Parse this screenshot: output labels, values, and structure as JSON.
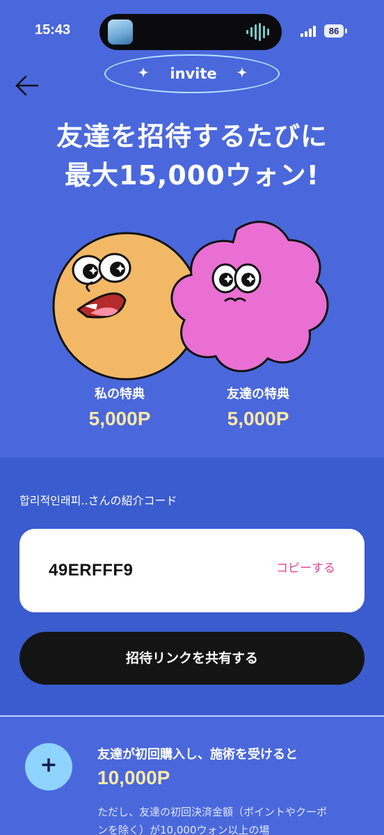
{
  "status_bar": {
    "time": "15:43",
    "battery": "86"
  },
  "header": {
    "badge": "invite"
  },
  "headline": {
    "line1": "友達を招待するたびに",
    "line2": "最大15,000ウォン!"
  },
  "benefits": {
    "mine": {
      "label": "私の特典",
      "value": "5,000P"
    },
    "friend": {
      "label": "友達の特典",
      "value": "5,000P"
    }
  },
  "code_section": {
    "caption": "합리적인래피..さんの紹介コード",
    "code": "49ERFFF9",
    "copy_label": "コピーする",
    "share_label": "招待リンクを共有する"
  },
  "reward": {
    "plus": "+",
    "title": "友達が初回購入し、施術を受けると",
    "amount": "10,000P",
    "note": "ただし、友達の初回決済金額（ポイントやクーポンを除く）が10,000ウォン以上の場"
  },
  "colors": {
    "background": "#4a68dc",
    "lower_panel": "#3a5ccf",
    "accent_yellow": "#fbe9a6",
    "copy_pink": "#e3468f",
    "orange_character": "#f2b866",
    "pink_character": "#ea6fd2"
  }
}
